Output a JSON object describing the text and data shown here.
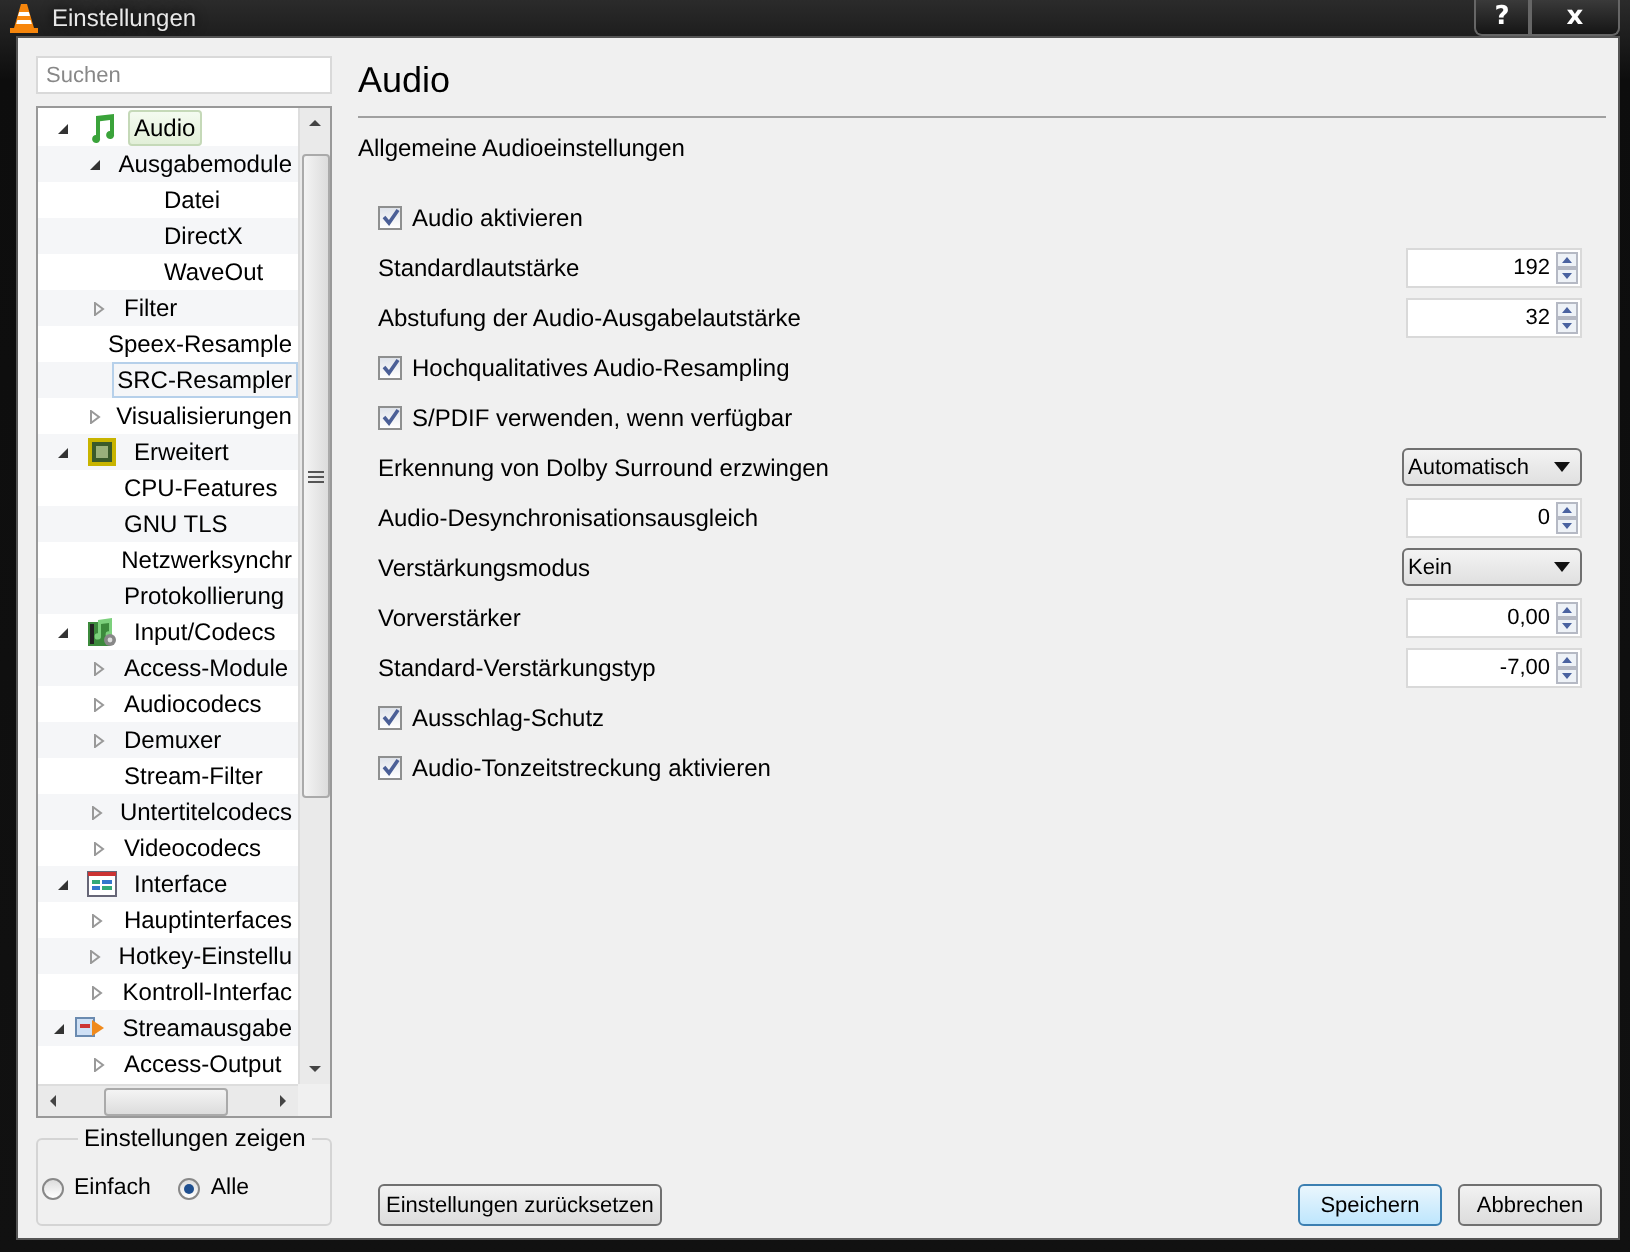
{
  "window": {
    "title": "Einstellungen",
    "buttons": [
      "?",
      "x"
    ]
  },
  "search": {
    "placeholder": "Suchen"
  },
  "tree": [
    {
      "label": "Audio",
      "kind": "audio",
      "expanded": true,
      "selected": true,
      "focused": false,
      "children": [
        {
          "label": "Ausgabemodule",
          "expanded": true,
          "selected": false,
          "focused": false,
          "children": [
            {
              "label": "Datei",
              "selected": false,
              "focused": false
            },
            {
              "label": "DirectX",
              "selected": false,
              "focused": false
            },
            {
              "label": "WaveOut",
              "selected": false,
              "focused": false
            }
          ]
        },
        {
          "label": "Filter",
          "expanded": false,
          "selected": false,
          "focused": false
        },
        {
          "label": "Speex-Resample",
          "selected": false,
          "focused": false
        },
        {
          "label": "SRC-Resampler",
          "selected": false,
          "focused": true
        },
        {
          "label": "Visualisierungen",
          "expanded": false,
          "selected": false,
          "focused": false
        }
      ]
    },
    {
      "label": "Erweitert",
      "kind": "advanced",
      "expanded": true,
      "selected": false,
      "focused": false,
      "children": [
        {
          "label": "CPU-Features",
          "selected": false,
          "focused": false
        },
        {
          "label": "GNU TLS",
          "selected": false,
          "focused": false
        },
        {
          "label": "Netzwerksynchr",
          "selected": false,
          "focused": false
        },
        {
          "label": "Protokollierung",
          "selected": false,
          "focused": false
        }
      ]
    },
    {
      "label": "Input/Codecs",
      "kind": "codecs",
      "expanded": true,
      "selected": false,
      "focused": false,
      "children": [
        {
          "label": "Access-Module",
          "expanded": false,
          "selected": false,
          "focused": false
        },
        {
          "label": "Audiocodecs",
          "expanded": false,
          "selected": false,
          "focused": false
        },
        {
          "label": "Demuxer",
          "expanded": false,
          "selected": false,
          "focused": false
        },
        {
          "label": "Stream-Filter",
          "selected": false,
          "focused": false
        },
        {
          "label": "Untertitelcodecs",
          "expanded": false,
          "selected": false,
          "focused": false
        },
        {
          "label": "Videocodecs",
          "expanded": false,
          "selected": false,
          "focused": false
        }
      ]
    },
    {
      "label": "Interface",
      "kind": "interface",
      "expanded": true,
      "selected": false,
      "focused": false,
      "children": [
        {
          "label": "Hauptinterfaces",
          "expanded": false,
          "selected": false,
          "focused": false
        },
        {
          "label": "Hotkey-Einstellu",
          "expanded": false,
          "selected": false,
          "focused": false
        },
        {
          "label": "Kontroll-Interfac",
          "expanded": false,
          "selected": false,
          "focused": false
        }
      ]
    },
    {
      "label": "Streamausgabe",
      "kind": "stream",
      "expanded": true,
      "selected": false,
      "focused": false,
      "children": [
        {
          "label": "Access-Output",
          "expanded": false,
          "selected": false,
          "focused": false
        }
      ]
    }
  ],
  "show_settings": {
    "title": "Einstellungen zeigen",
    "options": [
      {
        "label": "Einfach",
        "selected": false
      },
      {
        "label": "Alle",
        "selected": true
      }
    ]
  },
  "panel": {
    "title": "Audio",
    "subtitle": "Allgemeine Audioeinstellungen"
  },
  "settings": [
    {
      "kind": "checkbox",
      "label": "Audio aktivieren",
      "checked": true
    },
    {
      "kind": "spin",
      "label": "Standardlautstärke",
      "value": "192"
    },
    {
      "kind": "spin",
      "label": "Abstufung der Audio-Ausgabelautstärke",
      "value": "32"
    },
    {
      "kind": "checkbox",
      "label": "Hochqualitatives Audio-Resampling",
      "checked": true
    },
    {
      "kind": "checkbox",
      "label": "S/PDIF verwenden, wenn verfügbar",
      "checked": true
    },
    {
      "kind": "select",
      "label": "Erkennung von Dolby Surround erzwingen",
      "value": "Automatisch"
    },
    {
      "kind": "spin",
      "label": "Audio-Desynchronisationsausgleich",
      "value": "0"
    },
    {
      "kind": "select",
      "label": "Verstärkungsmodus",
      "value": "Kein"
    },
    {
      "kind": "spin",
      "label": "Vorverstärker",
      "value": "0,00"
    },
    {
      "kind": "spin",
      "label": "Standard-Verstärkungstyp",
      "value": "-7,00"
    },
    {
      "kind": "checkbox",
      "label": "Ausschlag-Schutz",
      "checked": true
    },
    {
      "kind": "checkbox",
      "label": "Audio-Tonzeitstreckung aktivieren",
      "checked": true
    }
  ],
  "buttons": {
    "reset": "Einstellungen zurücksetzen",
    "save": "Speichern",
    "cancel": "Abbrechen"
  }
}
